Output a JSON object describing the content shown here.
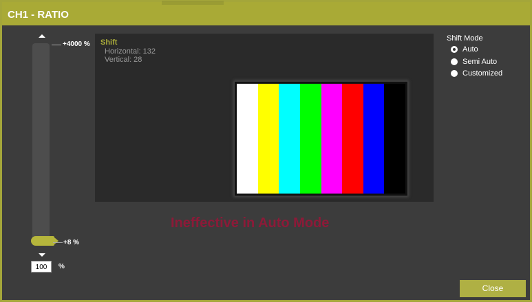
{
  "dialog": {
    "title": "CH1 - RATIO",
    "close_label": "Close"
  },
  "slider": {
    "max_label": "+4000 %",
    "min_label": "+8 %",
    "value": "100",
    "unit": "%",
    "level_fraction": 0.0
  },
  "shift": {
    "title": "Shift",
    "horizontal": "Horizontal: 132",
    "vertical": "Vertical: 28"
  },
  "preview": {
    "bar_colors": [
      "#ffffff",
      "#ffff00",
      "#00ffff",
      "#00ff00",
      "#ff00ff",
      "#ff0000",
      "#0000ff",
      "#000000"
    ],
    "warning": "Ineffective in Auto Mode"
  },
  "shift_mode": {
    "title": "Shift Mode",
    "options": [
      {
        "label": "Auto",
        "checked": true
      },
      {
        "label": "Semi Auto",
        "checked": false
      },
      {
        "label": "Customized",
        "checked": false
      }
    ]
  }
}
